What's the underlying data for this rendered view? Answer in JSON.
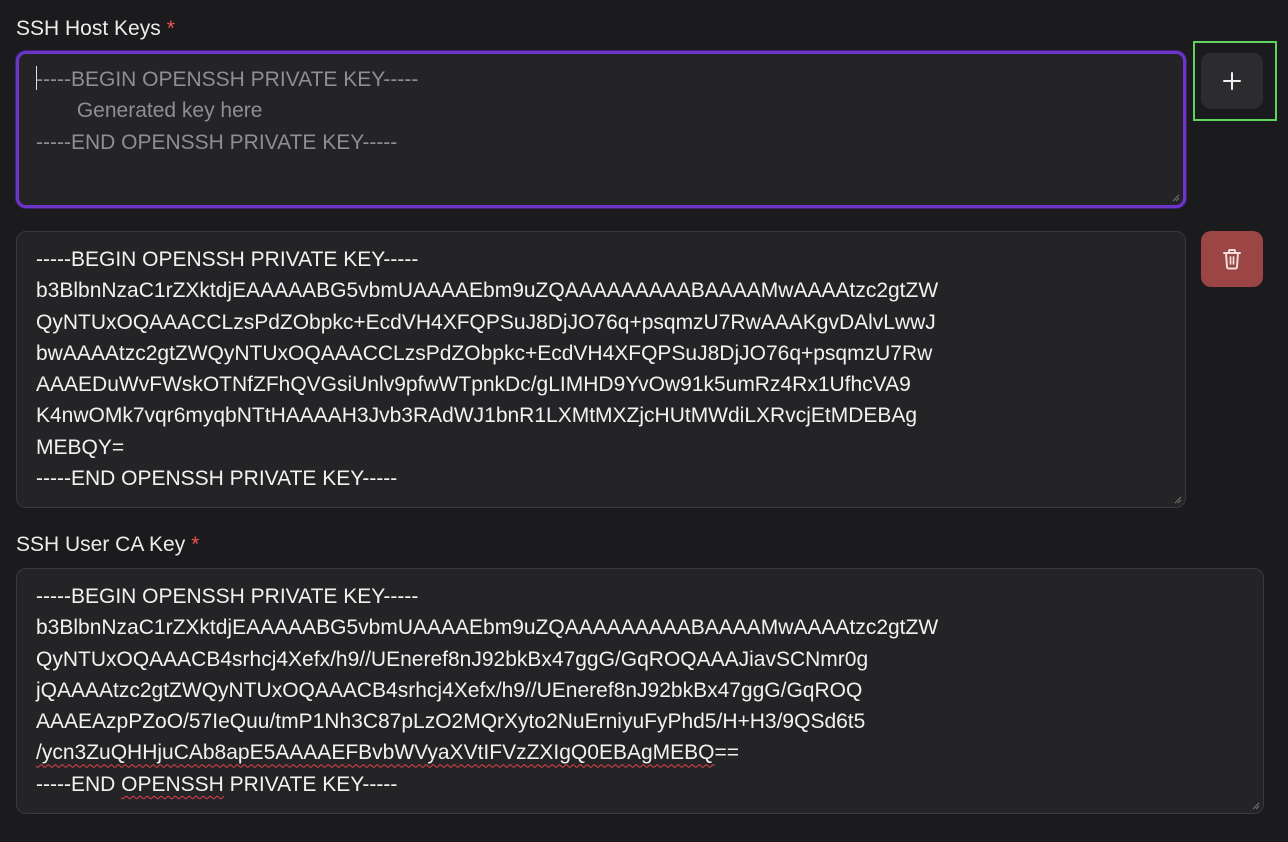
{
  "host_keys": {
    "label": "SSH Host Keys",
    "required_mark": "*",
    "new_key_placeholder": {
      "line1": "-----BEGIN OPENSSH PRIVATE KEY-----",
      "line2": "       Generated key here",
      "line3": "-----END OPENSSH PRIVATE KEY-----"
    },
    "existing_key": {
      "value": "-----BEGIN OPENSSH PRIVATE KEY-----\nb3BlbnNzaC1rZXktdjEAAAAABG5vbmUAAAAEbm9uZQAAAAAAAAABAAAAMwAAAAtzc2gtZW\nQyNTUxOQAAACCLzsPdZObpkc+EcdVH4XFQPSuJ8DjJO76q+psqmzU7RwAAAKgvDAlvLwwJ\nbwAAAAtzc2gtZWQyNTUxOQAAACCLzsPdZObpkc+EcdVH4XFQPSuJ8DjJO76q+psqmzU7Rw\nAAAEDuWvFWskOTNfZFhQVGsiUnlv9pfwWTpnkDc/gLIMHD9YvOw91k5umRz4Rx1UfhcVA9\nK4nwOMk7vqr6myqbNTtHAAAAH3Jvb3RAdWJ1bnR1LXMtMXZjcHUtMWdiLXRvcjEtMDEBAg\nMEBQY=\n-----END OPENSSH PRIVATE KEY-----"
    },
    "add_button_icon": "plus-icon",
    "delete_button_icon": "trash-icon"
  },
  "user_ca_key": {
    "label": "SSH User CA Key",
    "required_mark": "*",
    "lines": {
      "l1": "-----BEGIN OPENSSH PRIVATE KEY-----",
      "l2": "b3BlbnNzaC1rZXktdjEAAAAABG5vbmUAAAAEbm9uZQAAAAAAAAABAAAAMwAAAAtzc2gtZW",
      "l3": "QyNTUxOQAAACB4srhcj4Xefx/h9//UEneref8nJ92bkBx47ggG/GqROQAAAJiavSCNmr0g",
      "l4": "jQAAAAtzc2gtZWQyNTUxOQAAACB4srhcj4Xefx/h9//UEneref8nJ92bkBx47ggG/GqROQ",
      "l5": "AAAEAzpPZoO/57IeQuu/tmP1Nh3C87pLzO2MQrXyto2NuErniyuFyPhd5/H+H3/9QSd6t5",
      "l6a": "/ycn3ZuQHHjuCAb8apE5AAAAEFBvbWVyaXVtIFVzZXIgQ0EBAgMEBQ",
      "l6b": "==",
      "l7a": "-----END ",
      "l7b": "OPENSSH",
      "l7c": " PRIVATE KEY-----"
    }
  },
  "colors": {
    "background": "#1b1b1d",
    "field": "#242426",
    "focus_ring": "#6c35c8",
    "required": "#f05252",
    "delete": "#9b4545",
    "highlight": "#5ed35e"
  }
}
